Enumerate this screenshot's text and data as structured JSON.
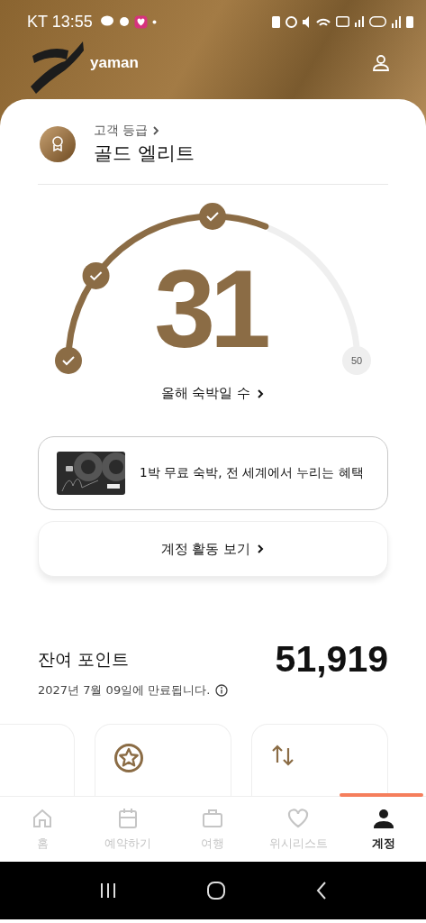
{
  "status_bar": {
    "carrier_time": "KT 13:55"
  },
  "header": {
    "user_name": "yaman"
  },
  "tier": {
    "label": "고객 등급",
    "name": "골드 엘리트"
  },
  "stay_gauge": {
    "value": "31",
    "max_label": "50",
    "caption": "올해 숙박일 수",
    "milestones": [
      {
        "checked": true
      },
      {
        "checked": true
      },
      {
        "checked": true
      }
    ]
  },
  "card_promo": {
    "text": "1박 무료 숙박, 전 세계에서 누리는 혜택"
  },
  "activity_button": {
    "label": "계정 활동 보기"
  },
  "points": {
    "label": "잔여 포인트",
    "value": "51,919",
    "expiry": "2027년 7월 09일에 만료됩니다."
  },
  "action_cards": [
    {
      "kind": "blank"
    },
    {
      "kind": "star"
    },
    {
      "kind": "arrows"
    }
  ],
  "bottom_nav": [
    {
      "label": "홈",
      "kind": "home",
      "selected": false
    },
    {
      "label": "예약하기",
      "kind": "calendar",
      "selected": false
    },
    {
      "label": "여행",
      "kind": "suitcase",
      "selected": false
    },
    {
      "label": "위시리스트",
      "kind": "heart",
      "selected": false
    },
    {
      "label": "계정",
      "kind": "person",
      "selected": true
    }
  ]
}
